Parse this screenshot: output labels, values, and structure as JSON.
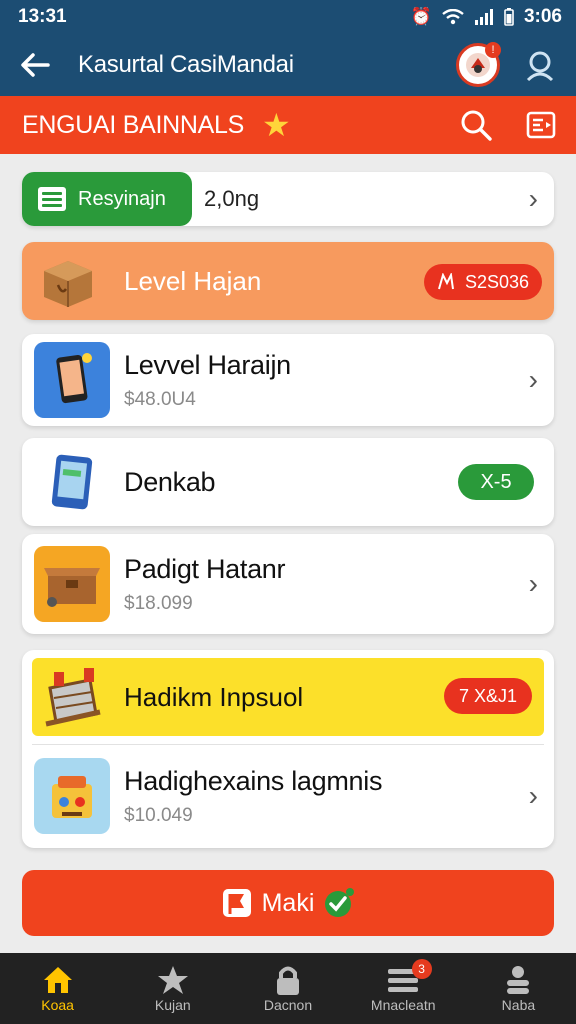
{
  "status_bar": {
    "time_left": "13:31",
    "time_right": "3:06"
  },
  "app_bar": {
    "title": "Kasurtal CasiMandai"
  },
  "section_bar": {
    "heading": "ENGUAI BAINNALS"
  },
  "summary": {
    "pill_label": "Resyinajn",
    "value": "2,0ng"
  },
  "level_card": {
    "label": "Level Hajan",
    "badge": "S2S036"
  },
  "items": [
    {
      "name": "Levvel Haraijn",
      "price": "$48.0U4"
    },
    {
      "name": "Denkab",
      "badge": "X-5"
    },
    {
      "name": "Padigt Hatanr",
      "price": "$18.099"
    }
  ],
  "group": {
    "highlight": {
      "name": "Hadikm Inpsuol",
      "badge": "7 X&J1"
    },
    "sub": {
      "name": "Hadighexains lagmnis",
      "price": "$10.049"
    }
  },
  "action_button": {
    "label": "Maki"
  },
  "bottom_nav": [
    {
      "label": "Koaa",
      "active": true
    },
    {
      "label": "Kujan"
    },
    {
      "label": "Dacnon"
    },
    {
      "label": "Mnacleatn",
      "badge": "3"
    },
    {
      "label": "Naba"
    }
  ],
  "colors": {
    "header_bg": "#1c4d73",
    "accent_red": "#f0431e",
    "green": "#2a9a3a",
    "orange_card": "#f79a5e",
    "yellow_highlight": "#fce02a",
    "nav_bg": "#222222",
    "nav_active": "#ffc400"
  }
}
